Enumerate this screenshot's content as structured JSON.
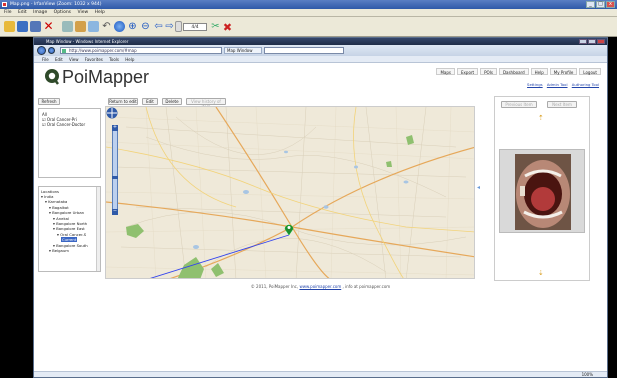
{
  "viewer": {
    "title": "Map.png - IrfanView (Zoom: 1032 x 944)",
    "menu": [
      "File",
      "Edit",
      "Image",
      "Options",
      "View",
      "Help"
    ],
    "page_counter": "4/4"
  },
  "browser": {
    "title": "Map Window - Windows Internet Explorer",
    "address": "http://www.poimapper.com/#map",
    "tab_label": "Map Window",
    "menu": [
      "File",
      "Edit",
      "View",
      "Favorites",
      "Tools",
      "Help"
    ],
    "status_zoom": "100%"
  },
  "app": {
    "logo_text": "PoiMapper",
    "top_nav": [
      "Maps",
      "Export",
      "POIs",
      "Dashboard",
      "Help",
      "My Profile",
      "Logout"
    ],
    "sub_nav": [
      "Settings",
      "Admin Tool",
      "Authoring Tool"
    ],
    "buttons": {
      "refresh": "Refresh",
      "return_to_edit": "Return to edit",
      "edit": "Edit",
      "delete": "Delete",
      "view_history": "View history of item"
    },
    "layers": {
      "label": "All",
      "items": [
        "Oral Cancer-Pri",
        "Oral Cancer-Doctor"
      ]
    },
    "locations": {
      "label": "Locations",
      "tree": [
        {
          "text": "India",
          "depth": 0
        },
        {
          "text": "Karnataka",
          "depth": 1
        },
        {
          "text": "Bagalkot",
          "depth": 2
        },
        {
          "text": "Bangalore Urban",
          "depth": 2
        },
        {
          "text": "Anekal",
          "depth": 3
        },
        {
          "text": "Bangalore North",
          "depth": 3
        },
        {
          "text": "Bangalore East",
          "depth": 3
        },
        {
          "text": "Oral Cancer-S",
          "depth": 4
        },
        {
          "text": "Current",
          "depth": 5,
          "selected": true
        },
        {
          "text": "Bangalore South",
          "depth": 3
        },
        {
          "text": "Belgaum",
          "depth": 2
        }
      ]
    },
    "right_panel": {
      "prev_label": "Previous Item",
      "next_label": "Next Item"
    },
    "footer": {
      "prefix": "© 2011, PoiMapper Inc,",
      "link": "www.poimapper.com",
      "suffix": ", info at poimapper.com"
    }
  },
  "colors": {
    "accent": "#2f5aa8",
    "marker": "#1f8a2e",
    "map_bg": "#efe9d9"
  },
  "icons": [
    "open-icon",
    "save-icon",
    "delete-icon",
    "rotate-icon",
    "zoom-in-icon",
    "zoom-out-icon",
    "prev-icon",
    "next-icon",
    "close-icon",
    "map-marker-icon",
    "arrow-up-icon",
    "arrow-down-icon"
  ]
}
